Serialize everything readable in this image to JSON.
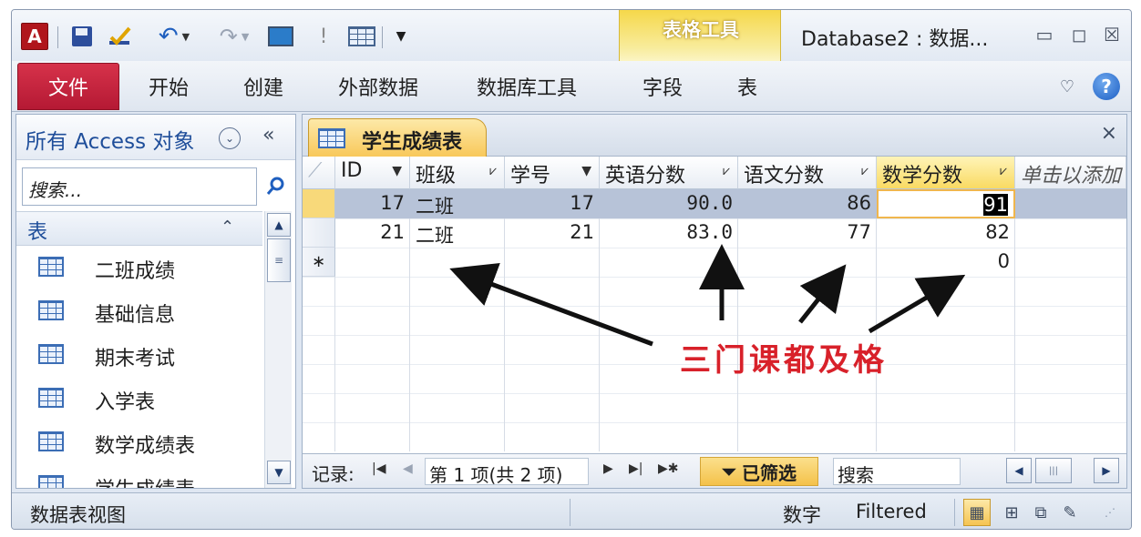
{
  "titlebar": {
    "app_icon": "A",
    "context_tab_group": "表格工具",
    "window_title": "Database2 : 数据...",
    "buttons": {
      "minimize": "▭",
      "restore": "◻",
      "close": "☒"
    }
  },
  "ribbon": {
    "tabs": [
      "文件",
      "开始",
      "创建",
      "外部数据",
      "数据库工具",
      "字段",
      "表"
    ],
    "minimize_icon": "♡",
    "help": "?"
  },
  "nav_pane": {
    "title": "所有 Access 对象",
    "dropdown": "⌄",
    "collapse": "«",
    "search_placeholder": "搜索...",
    "search_icon": "⌕",
    "group_label": "表",
    "group_chevron": "⌃",
    "items": [
      "二班成绩",
      "基础信息",
      "期末考试",
      "入学表",
      "数学成绩表",
      "学生成绩表"
    ]
  },
  "document": {
    "tab_label": "学生成绩表",
    "close": "×",
    "columns": [
      "ID",
      "班级",
      "学号",
      "英语分数",
      "语文分数",
      "数学分数",
      "单击以添加"
    ],
    "rows": [
      {
        "id": "17",
        "class": "二班",
        "student_no": "17",
        "english": "90.0",
        "chinese": "86",
        "math": "91"
      },
      {
        "id": "21",
        "class": "二班",
        "student_no": "21",
        "english": "83.0",
        "chinese": "77",
        "math": "82"
      }
    ],
    "new_row_marker": "∗",
    "new_row_math_default": "0",
    "annotation": "三门课都及格"
  },
  "record_nav": {
    "label": "记录:",
    "first": "|◀",
    "prev": "◀",
    "position": "第 1 项(共 2 项)",
    "next": "▶",
    "last": "▶|",
    "new": "▶✱",
    "filter_state": "已筛选",
    "search_placeholder": "搜索"
  },
  "status_bar": {
    "view_name": "数据表视图",
    "num_lock": "数字",
    "filtered": "Filtered"
  },
  "colors": {
    "file_tab": "#c4233c",
    "context_tab": "#f6d84a",
    "annotation": "#d8212a",
    "selected_row": "#b7c3d8"
  }
}
